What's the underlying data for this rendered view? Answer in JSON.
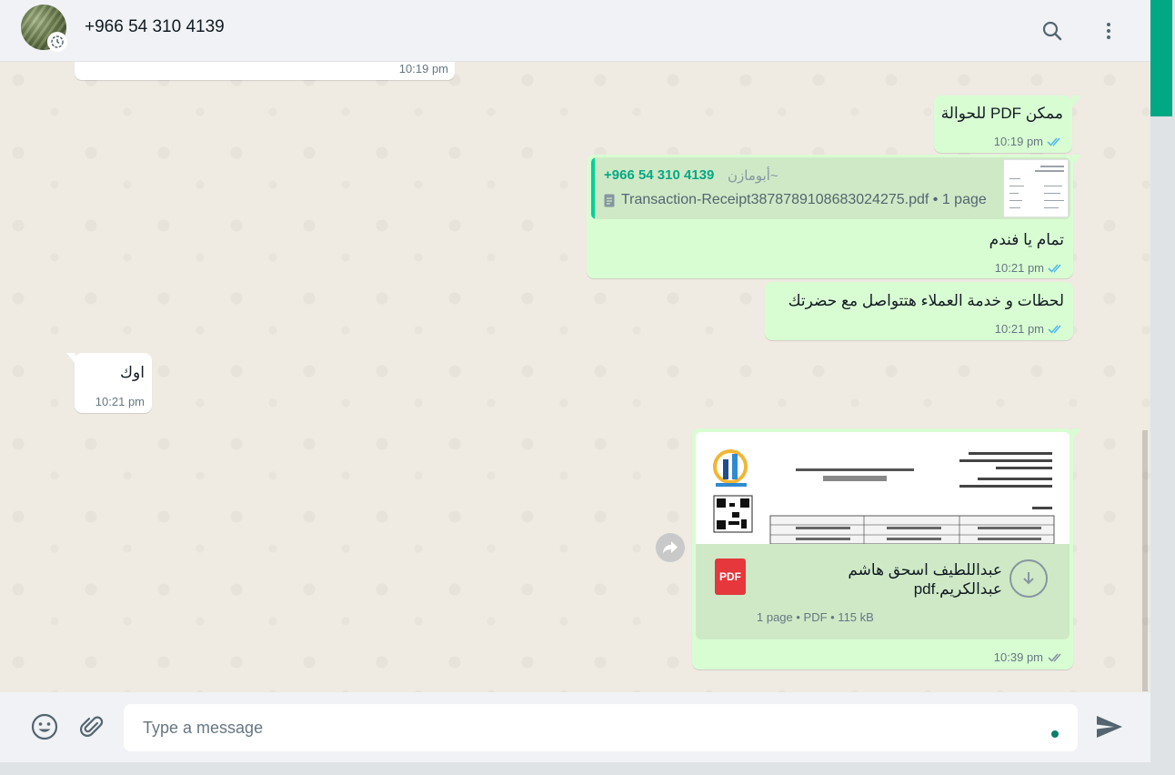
{
  "header": {
    "contact_name": "+966 54 310 4139"
  },
  "messages": {
    "m0": {
      "time": "10:19 pm"
    },
    "m1": {
      "text": "ممكن PDF للحوالة",
      "time": "10:19 pm"
    },
    "m2": {
      "quote_number": "+966 54 310 4139",
      "quote_alias": "~أبومازن",
      "quote_file": "Transaction-Receipt3878789108683024275.pdf • 1 page",
      "text": "تمام يا فندم",
      "time": "10:21 pm"
    },
    "m3": {
      "text": "لحظات و خدمة العملاء هتتواصل مع حضرتك",
      "time": "10:21 pm"
    },
    "m4": {
      "text": "اوك",
      "time": "10:21 pm"
    },
    "m5": {
      "file_name": "عبداللطيف اسحق هاشم عبدالكريم.pdf",
      "pdf_label": "PDF",
      "meta": "1 page • PDF • 115 kB",
      "time": "10:39 pm"
    }
  },
  "footer": {
    "placeholder": "Type a message"
  },
  "colors": {
    "accent": "#00a884",
    "outgoing_bubble": "#d9fdd3",
    "incoming_bubble": "#ffffff",
    "read_ticks": "#53bdeb"
  }
}
